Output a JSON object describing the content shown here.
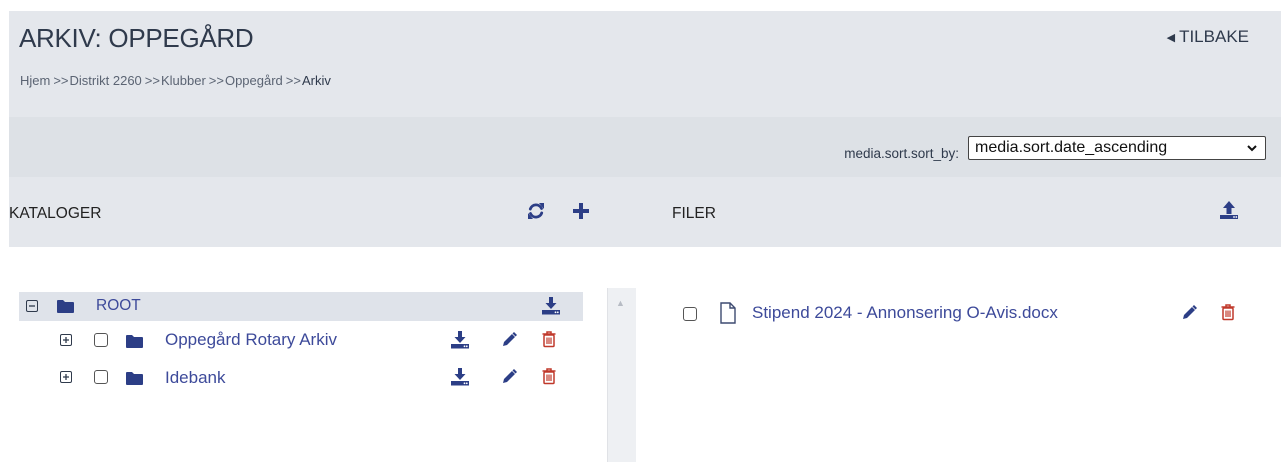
{
  "header": {
    "title": "ARKIV: OPPEGÅRD",
    "back_label": "TILBAKE",
    "breadcrumb": {
      "items": [
        "Hjem",
        "Distrikt 2260",
        "Klubber",
        "Oppegård",
        "Arkiv"
      ],
      "separator": ">>"
    }
  },
  "sort": {
    "label": "media.sort.sort_by:",
    "selected": "media.sort.date_ascending"
  },
  "catalogs": {
    "title": "KATALOGER",
    "root_label": "ROOT",
    "items": [
      {
        "label": "Oppegård Rotary Arkiv"
      },
      {
        "label": "Idebank"
      }
    ]
  },
  "files": {
    "title": "FILER",
    "items": [
      {
        "name": "Stipend 2024 - Annonsering O-Avis.docx"
      }
    ]
  },
  "colors": {
    "accent": "#2f3a4c",
    "link": "#3d4a9a",
    "delete": "#c0392b",
    "header_bg": "#e4e7ec"
  }
}
